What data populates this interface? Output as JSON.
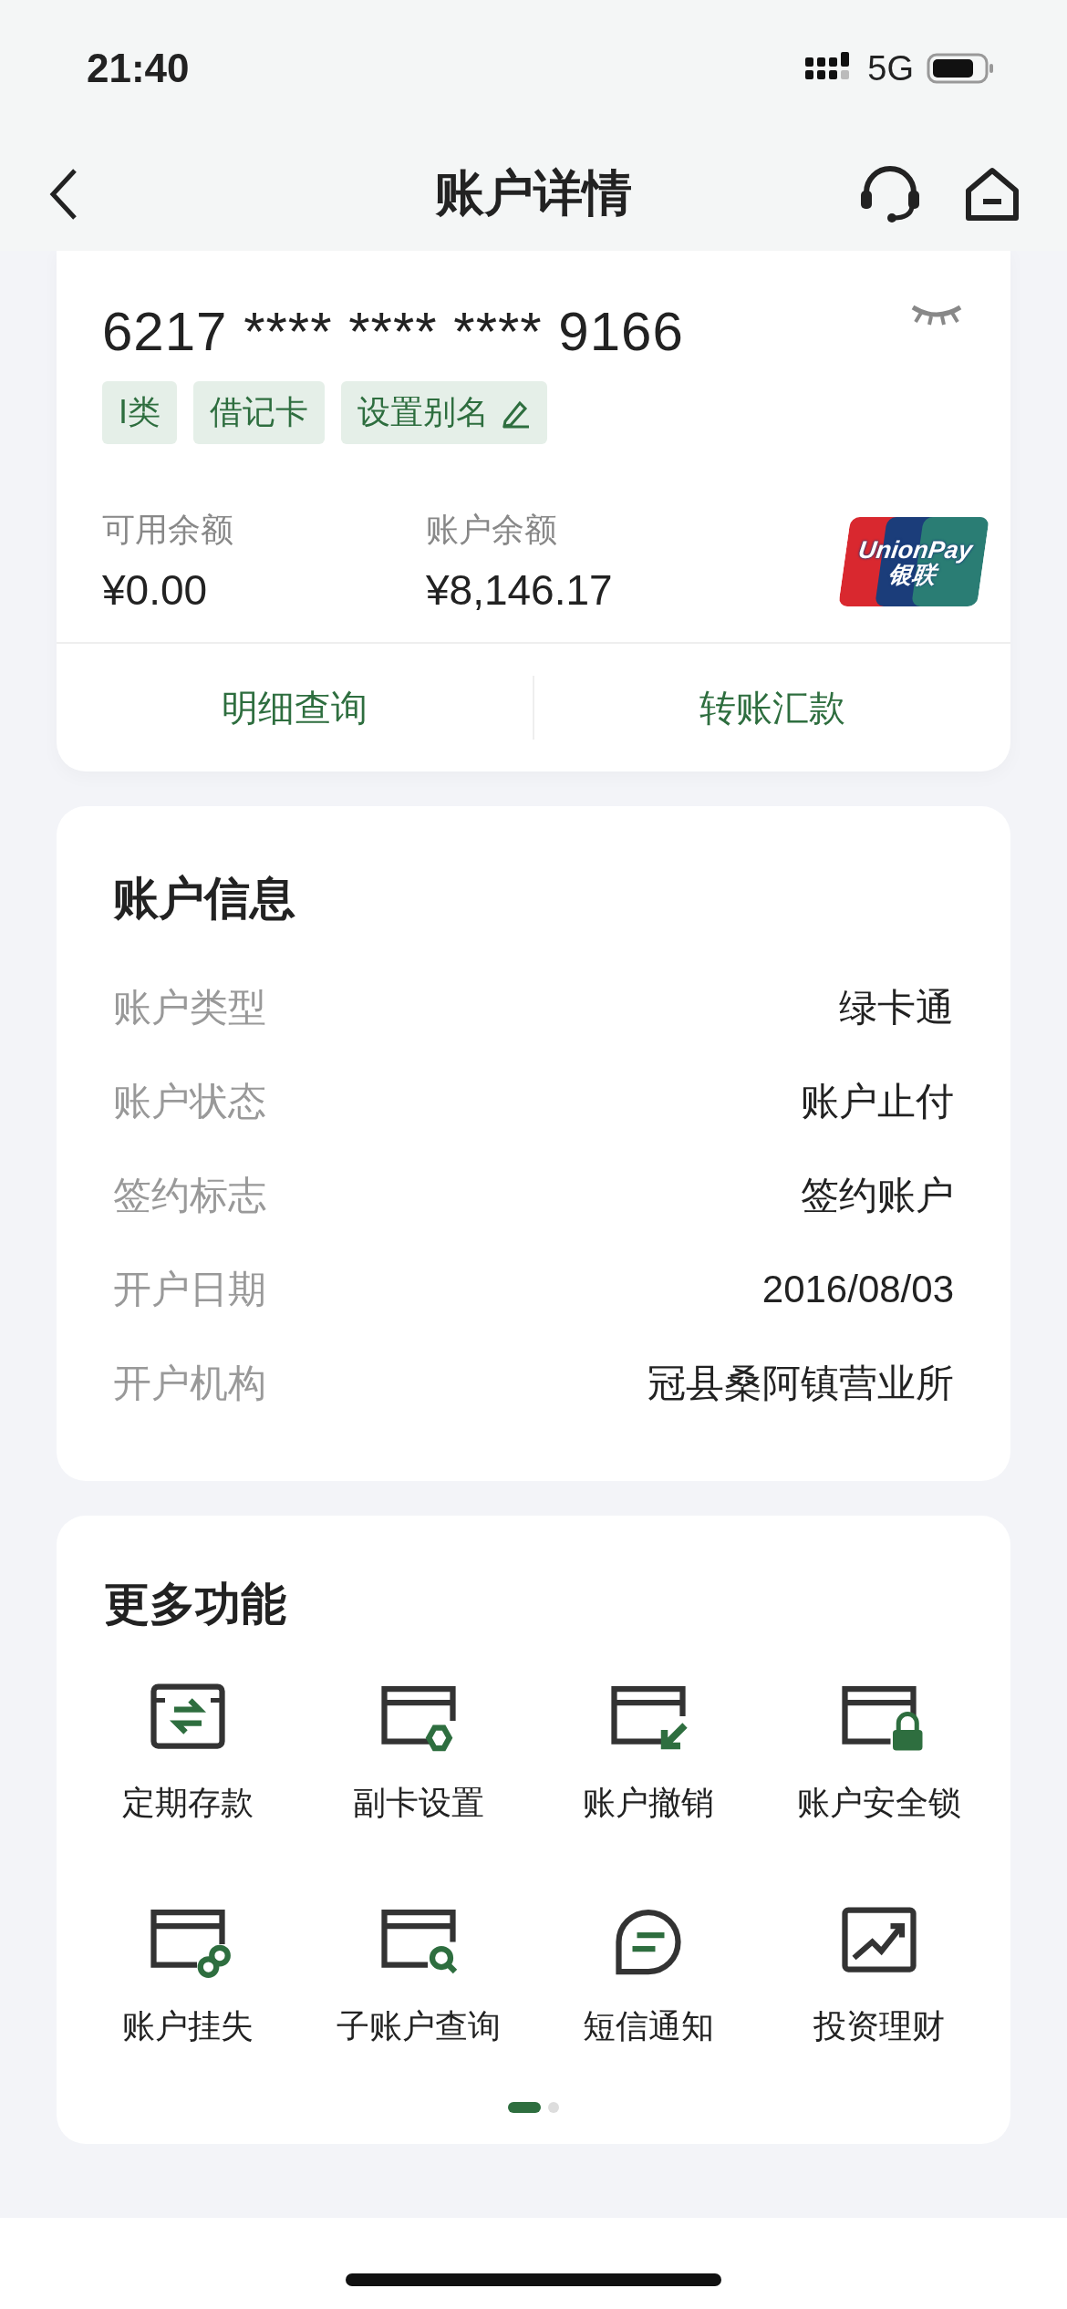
{
  "status_bar": {
    "time": "21:40",
    "network": "5G"
  },
  "nav": {
    "title": "账户详情"
  },
  "card": {
    "number": "6217 **** **** **** 9166",
    "tags": [
      {
        "label": "I类",
        "kind": "plain"
      },
      {
        "label": "借记卡",
        "kind": "plain"
      },
      {
        "label": "设置别名",
        "kind": "edit"
      }
    ],
    "balances": [
      {
        "label": "可用余额",
        "value": "¥0.00"
      },
      {
        "label": "账户余额",
        "value": "¥8,146.17"
      }
    ],
    "logo": {
      "text": "UnionPay",
      "subtext": "银联"
    },
    "actions": [
      "明细查询",
      "转账汇款"
    ]
  },
  "account_info": {
    "title": "账户信息",
    "rows": [
      {
        "label": "账户类型",
        "value": "绿卡通"
      },
      {
        "label": "账户状态",
        "value": "账户止付"
      },
      {
        "label": "签约标志",
        "value": "签约账户"
      },
      {
        "label": "开户日期",
        "value": "2016/08/03"
      },
      {
        "label": "开户机构",
        "value": "冠县桑阿镇营业所"
      }
    ]
  },
  "more_functions": {
    "title": "更多功能",
    "items": [
      {
        "label": "定期存款"
      },
      {
        "label": "副卡设置"
      },
      {
        "label": "账户撤销"
      },
      {
        "label": "账户安全锁"
      },
      {
        "label": "账户挂失"
      },
      {
        "label": "子账户查询"
      },
      {
        "label": "短信通知"
      },
      {
        "label": "投资理财"
      }
    ],
    "pages": [
      {
        "selected": true
      },
      {
        "selected": false
      }
    ]
  }
}
